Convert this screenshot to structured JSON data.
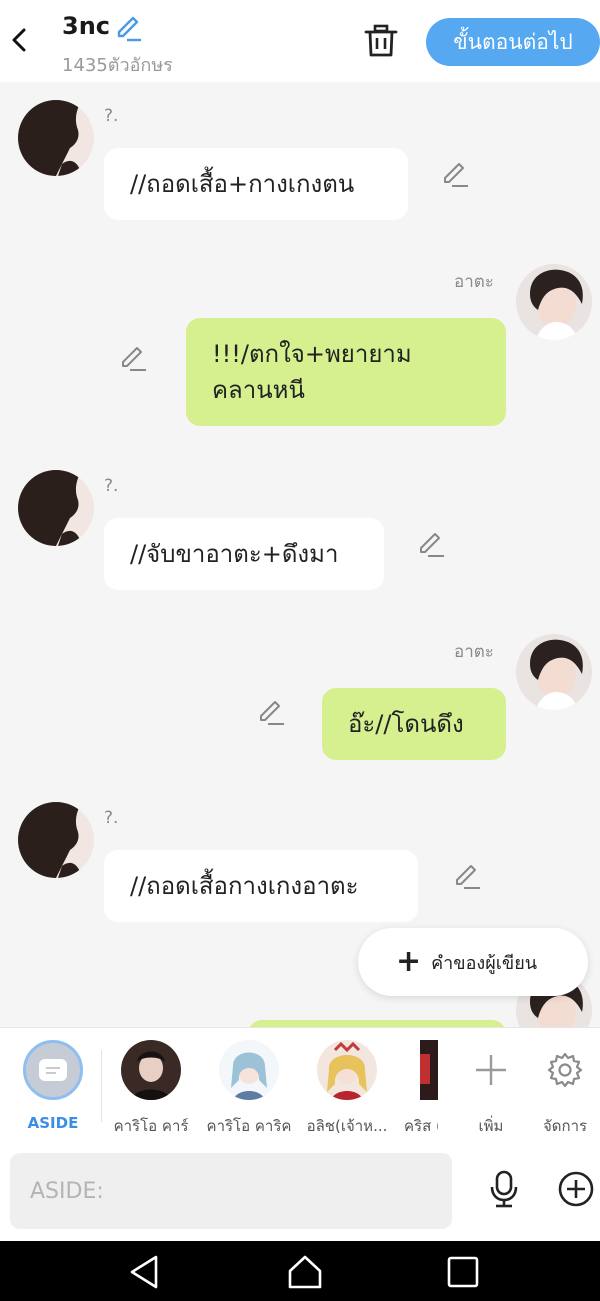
{
  "header": {
    "title": "3nc",
    "char_count": "1435ตัวอักษร",
    "next_label": "ขั้นตอนต่อไป"
  },
  "messages": [
    {
      "side": "left",
      "name": "?.",
      "text": "//ถอดเสื้อ+กางเกงตน"
    },
    {
      "side": "right",
      "name": "อาตะ",
      "text": "!!!/ตกใจ+พยายาม\nคลานหนี"
    },
    {
      "side": "left",
      "name": "?.",
      "text": "//จับขาอาตะ+ดึงมา"
    },
    {
      "side": "right",
      "name": "อาตะ",
      "text": "อ๊ะ//โดนดึง"
    },
    {
      "side": "left",
      "name": "?.",
      "text": "//ถอดเสื้อกางเกงอาตะ"
    }
  ],
  "fab": {
    "label": "คำของผู้เขียน"
  },
  "character_bar": {
    "aside_label": "ASIDE",
    "items": [
      {
        "label": "คาริโอ คาร์"
      },
      {
        "label": "คาริโอ คาริค"
      },
      {
        "label": "อลิช(เจ้าห..."
      },
      {
        "label": "คริส ("
      }
    ],
    "add_label": "เพิ่ม",
    "manage_label": "จัดการ"
  },
  "input": {
    "placeholder": "ASIDE:"
  },
  "colors": {
    "accent": "#56a8f0",
    "right_bubble": "#d6f08f",
    "left_bubble": "#ffffff",
    "aside_label": "#3a8ee8"
  }
}
